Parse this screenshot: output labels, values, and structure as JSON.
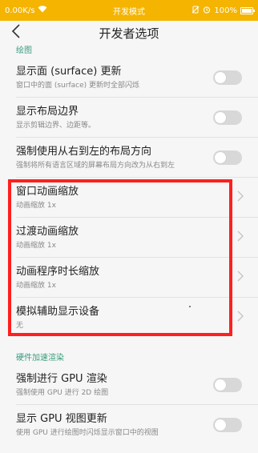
{
  "statusbar": {
    "speed": "0.00K/s",
    "carrier_mode": "开发模式",
    "battery": "100%",
    "icons": [
      "wifi-icon",
      "alarm-icon",
      "no-sim-icon",
      "battery-icon"
    ]
  },
  "header": {
    "title": "开发者选项",
    "back_icon": "chevron-left-icon"
  },
  "sections": [
    {
      "title": "绘图",
      "rows": [
        {
          "title": "显示面 (surface) 更新",
          "subtitle": "窗口中的面 (surface) 更新时全部闪烁",
          "control": "toggle",
          "on": false
        },
        {
          "title": "显示布局边界",
          "subtitle": "显示剪辑边界、边距等。",
          "control": "toggle",
          "on": false
        },
        {
          "title": "强制使用从右到左的布局方向",
          "subtitle": "强制将所有语言区域的屏幕布局方向改为从右到左",
          "control": "toggle",
          "on": false
        },
        {
          "title": "窗口动画缩放",
          "subtitle": "动画缩放 1x",
          "control": "chevron"
        },
        {
          "title": "过渡动画缩放",
          "subtitle": "动画缩放 1x",
          "control": "chevron"
        },
        {
          "title": "动画程序时长缩放",
          "subtitle": "动画缩放 1x",
          "control": "chevron"
        },
        {
          "title": "模拟辅助显示设备",
          "subtitle": "无",
          "control": "chevron"
        }
      ]
    },
    {
      "title": "硬件加速渲染",
      "rows": [
        {
          "title": "强制进行 GPU 渲染",
          "subtitle": "强制使用 GPU 进行 2D 绘图",
          "control": "toggle",
          "on": false
        },
        {
          "title": "显示 GPU 视图更新",
          "subtitle": "使用 GPU 进行绘图时闪烁显示窗口中的视图",
          "control": "toggle",
          "on": false
        }
      ]
    }
  ],
  "colors": {
    "statusbar": "#f4b400",
    "accent": "#3a9b7f",
    "highlight": "#ff1f1f"
  }
}
